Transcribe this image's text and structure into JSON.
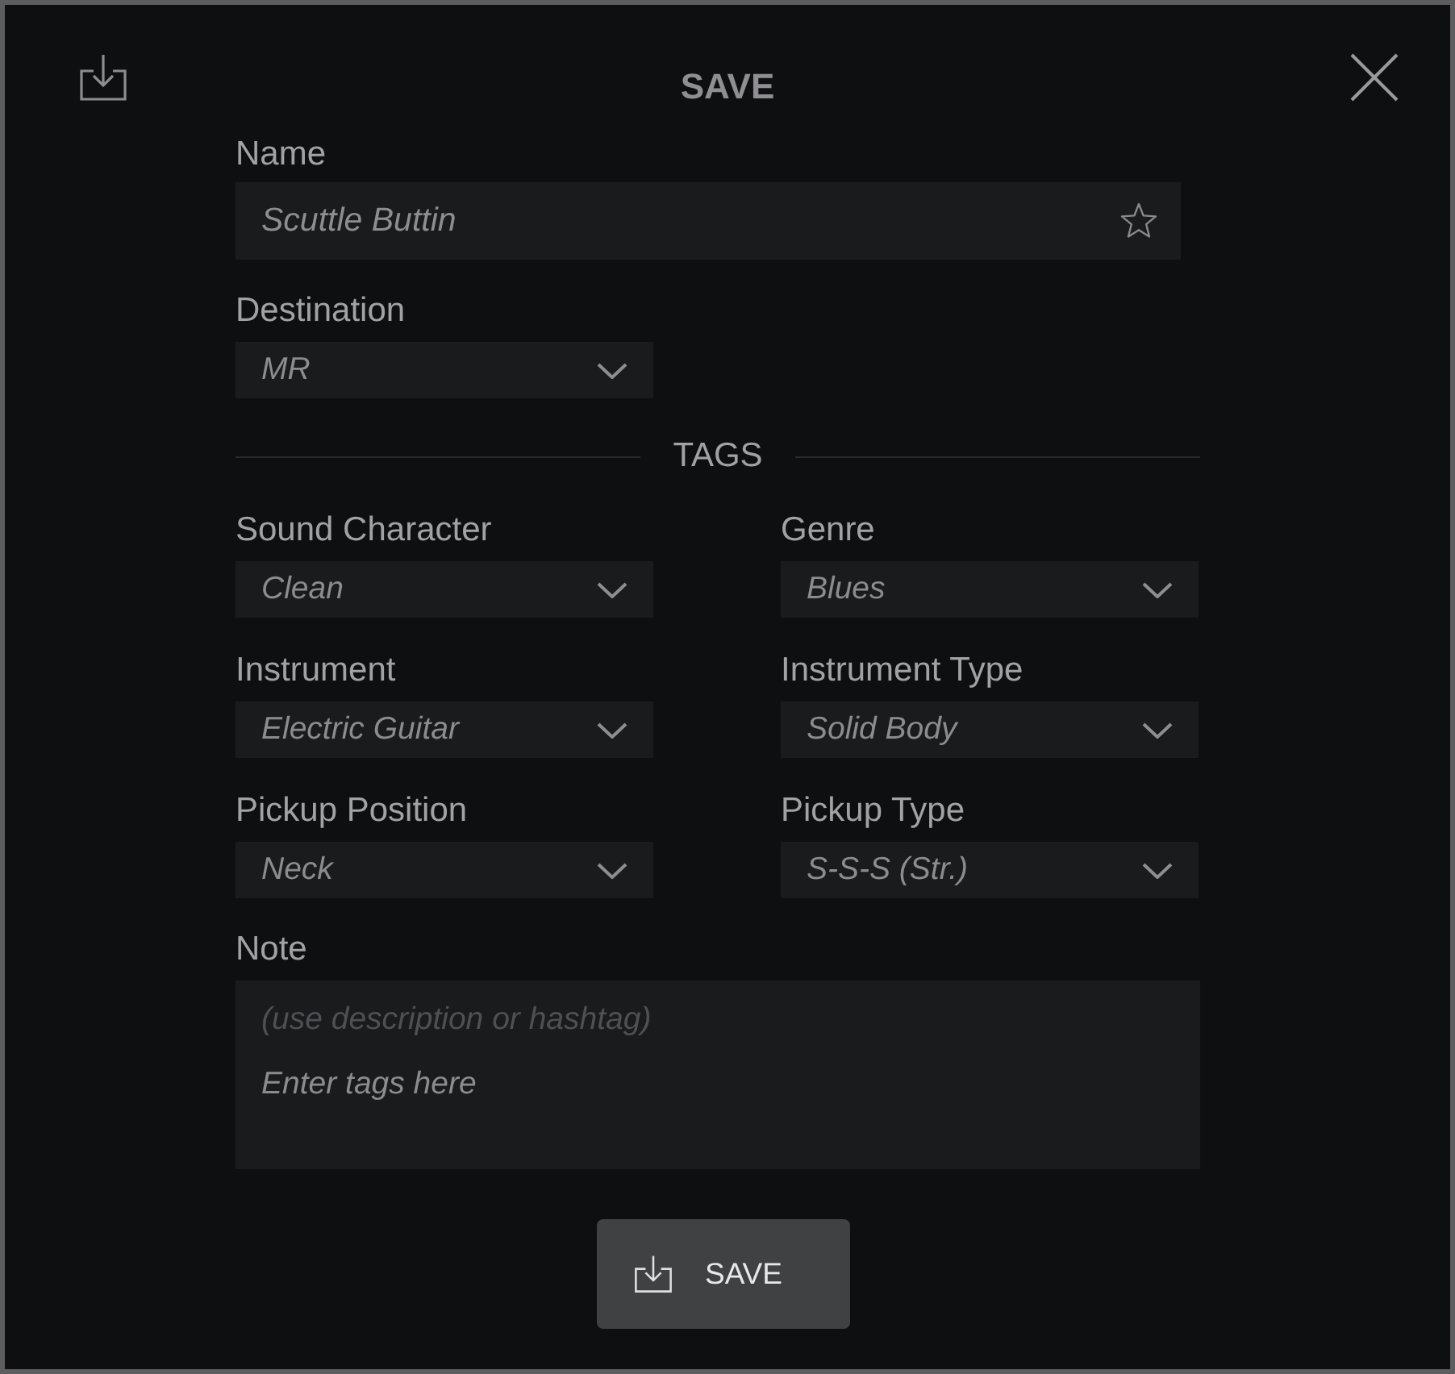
{
  "header": {
    "title": "SAVE"
  },
  "name": {
    "label": "Name",
    "value": "Scuttle Buttin",
    "favorite": false
  },
  "destination": {
    "label": "Destination",
    "value": "MR"
  },
  "tags": {
    "heading": "TAGS",
    "fields": [
      {
        "label": "Sound Character",
        "value": "Clean"
      },
      {
        "label": "Genre",
        "value": "Blues"
      },
      {
        "label": "Instrument",
        "value": "Electric Guitar"
      },
      {
        "label": "Instrument Type",
        "value": "Solid Body"
      },
      {
        "label": "Pickup Position",
        "value": "Neck"
      },
      {
        "label": "Pickup Type",
        "value": "S-S-S (Str.)"
      }
    ]
  },
  "note": {
    "label": "Note",
    "hint": "(use description or hashtag)",
    "placeholder": "Enter tags here"
  },
  "save_button": {
    "label": "SAVE"
  }
}
